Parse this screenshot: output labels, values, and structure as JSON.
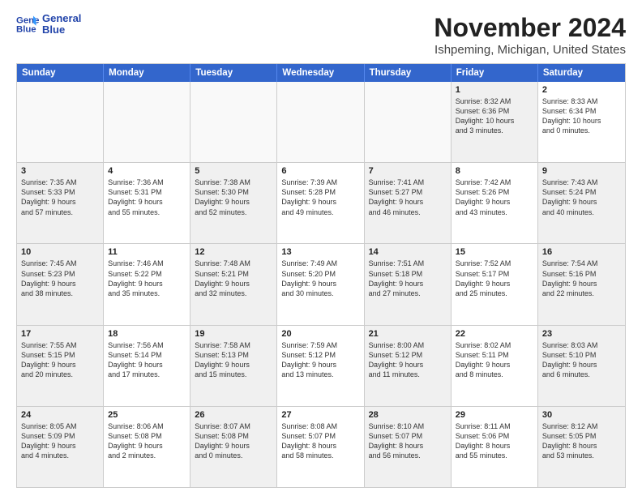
{
  "logo": {
    "line1": "General",
    "line2": "Blue"
  },
  "title": "November 2024",
  "subtitle": "Ishpeming, Michigan, United States",
  "headers": [
    "Sunday",
    "Monday",
    "Tuesday",
    "Wednesday",
    "Thursday",
    "Friday",
    "Saturday"
  ],
  "rows": [
    [
      {
        "day": "",
        "info": "",
        "empty": true
      },
      {
        "day": "",
        "info": "",
        "empty": true
      },
      {
        "day": "",
        "info": "",
        "empty": true
      },
      {
        "day": "",
        "info": "",
        "empty": true
      },
      {
        "day": "",
        "info": "",
        "empty": true
      },
      {
        "day": "1",
        "info": "Sunrise: 8:32 AM\nSunset: 6:36 PM\nDaylight: 10 hours\nand 3 minutes.",
        "shaded": true
      },
      {
        "day": "2",
        "info": "Sunrise: 8:33 AM\nSunset: 6:34 PM\nDaylight: 10 hours\nand 0 minutes.",
        "shaded": false
      }
    ],
    [
      {
        "day": "3",
        "info": "Sunrise: 7:35 AM\nSunset: 5:33 PM\nDaylight: 9 hours\nand 57 minutes.",
        "shaded": true
      },
      {
        "day": "4",
        "info": "Sunrise: 7:36 AM\nSunset: 5:31 PM\nDaylight: 9 hours\nand 55 minutes.",
        "shaded": false
      },
      {
        "day": "5",
        "info": "Sunrise: 7:38 AM\nSunset: 5:30 PM\nDaylight: 9 hours\nand 52 minutes.",
        "shaded": true
      },
      {
        "day": "6",
        "info": "Sunrise: 7:39 AM\nSunset: 5:28 PM\nDaylight: 9 hours\nand 49 minutes.",
        "shaded": false
      },
      {
        "day": "7",
        "info": "Sunrise: 7:41 AM\nSunset: 5:27 PM\nDaylight: 9 hours\nand 46 minutes.",
        "shaded": true
      },
      {
        "day": "8",
        "info": "Sunrise: 7:42 AM\nSunset: 5:26 PM\nDaylight: 9 hours\nand 43 minutes.",
        "shaded": false
      },
      {
        "day": "9",
        "info": "Sunrise: 7:43 AM\nSunset: 5:24 PM\nDaylight: 9 hours\nand 40 minutes.",
        "shaded": true
      }
    ],
    [
      {
        "day": "10",
        "info": "Sunrise: 7:45 AM\nSunset: 5:23 PM\nDaylight: 9 hours\nand 38 minutes.",
        "shaded": true
      },
      {
        "day": "11",
        "info": "Sunrise: 7:46 AM\nSunset: 5:22 PM\nDaylight: 9 hours\nand 35 minutes.",
        "shaded": false
      },
      {
        "day": "12",
        "info": "Sunrise: 7:48 AM\nSunset: 5:21 PM\nDaylight: 9 hours\nand 32 minutes.",
        "shaded": true
      },
      {
        "day": "13",
        "info": "Sunrise: 7:49 AM\nSunset: 5:20 PM\nDaylight: 9 hours\nand 30 minutes.",
        "shaded": false
      },
      {
        "day": "14",
        "info": "Sunrise: 7:51 AM\nSunset: 5:18 PM\nDaylight: 9 hours\nand 27 minutes.",
        "shaded": true
      },
      {
        "day": "15",
        "info": "Sunrise: 7:52 AM\nSunset: 5:17 PM\nDaylight: 9 hours\nand 25 minutes.",
        "shaded": false
      },
      {
        "day": "16",
        "info": "Sunrise: 7:54 AM\nSunset: 5:16 PM\nDaylight: 9 hours\nand 22 minutes.",
        "shaded": true
      }
    ],
    [
      {
        "day": "17",
        "info": "Sunrise: 7:55 AM\nSunset: 5:15 PM\nDaylight: 9 hours\nand 20 minutes.",
        "shaded": true
      },
      {
        "day": "18",
        "info": "Sunrise: 7:56 AM\nSunset: 5:14 PM\nDaylight: 9 hours\nand 17 minutes.",
        "shaded": false
      },
      {
        "day": "19",
        "info": "Sunrise: 7:58 AM\nSunset: 5:13 PM\nDaylight: 9 hours\nand 15 minutes.",
        "shaded": true
      },
      {
        "day": "20",
        "info": "Sunrise: 7:59 AM\nSunset: 5:12 PM\nDaylight: 9 hours\nand 13 minutes.",
        "shaded": false
      },
      {
        "day": "21",
        "info": "Sunrise: 8:00 AM\nSunset: 5:12 PM\nDaylight: 9 hours\nand 11 minutes.",
        "shaded": true
      },
      {
        "day": "22",
        "info": "Sunrise: 8:02 AM\nSunset: 5:11 PM\nDaylight: 9 hours\nand 8 minutes.",
        "shaded": false
      },
      {
        "day": "23",
        "info": "Sunrise: 8:03 AM\nSunset: 5:10 PM\nDaylight: 9 hours\nand 6 minutes.",
        "shaded": true
      }
    ],
    [
      {
        "day": "24",
        "info": "Sunrise: 8:05 AM\nSunset: 5:09 PM\nDaylight: 9 hours\nand 4 minutes.",
        "shaded": true
      },
      {
        "day": "25",
        "info": "Sunrise: 8:06 AM\nSunset: 5:08 PM\nDaylight: 9 hours\nand 2 minutes.",
        "shaded": false
      },
      {
        "day": "26",
        "info": "Sunrise: 8:07 AM\nSunset: 5:08 PM\nDaylight: 9 hours\nand 0 minutes.",
        "shaded": true
      },
      {
        "day": "27",
        "info": "Sunrise: 8:08 AM\nSunset: 5:07 PM\nDaylight: 8 hours\nand 58 minutes.",
        "shaded": false
      },
      {
        "day": "28",
        "info": "Sunrise: 8:10 AM\nSunset: 5:07 PM\nDaylight: 8 hours\nand 56 minutes.",
        "shaded": true
      },
      {
        "day": "29",
        "info": "Sunrise: 8:11 AM\nSunset: 5:06 PM\nDaylight: 8 hours\nand 55 minutes.",
        "shaded": false
      },
      {
        "day": "30",
        "info": "Sunrise: 8:12 AM\nSunset: 5:05 PM\nDaylight: 8 hours\nand 53 minutes.",
        "shaded": true
      }
    ]
  ]
}
